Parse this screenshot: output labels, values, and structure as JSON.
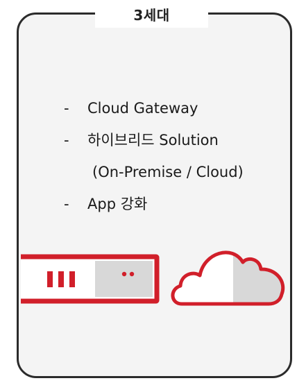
{
  "title": "3세대",
  "bullets": [
    {
      "dash": "-",
      "text": "Cloud Gateway"
    },
    {
      "dash": "-",
      "text": "하이브리드 Solution"
    },
    {
      "dash": "",
      "text": "(On-Premise / Cloud)"
    },
    {
      "dash": "-",
      "text": "App 강화"
    }
  ],
  "icons": {
    "server": "server-icon",
    "cloud": "cloud-icon"
  },
  "colors": {
    "accent": "#d11f2a",
    "frame": "#2b2b2b",
    "panel": "#f4f4f4",
    "icon_fill": "#d8d8d8"
  }
}
